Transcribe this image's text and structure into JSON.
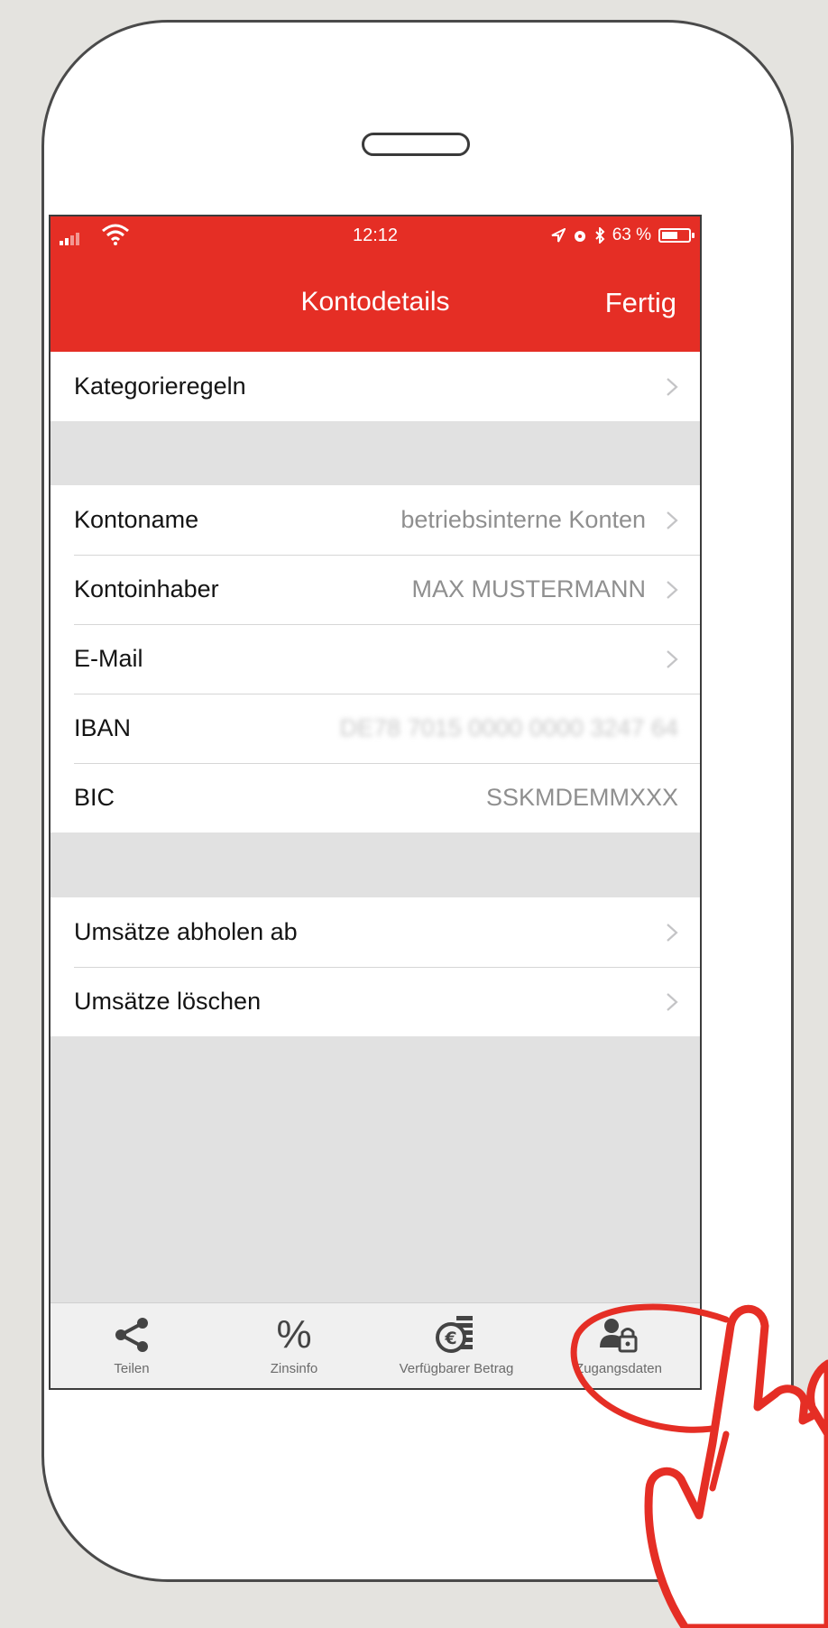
{
  "status_bar": {
    "time": "12:12",
    "battery": "63 %",
    "battery_level": 0.63
  },
  "nav": {
    "title": "Kontodetails",
    "done": "Fertig"
  },
  "sections": {
    "first": [
      {
        "label": "Kategorieregeln",
        "value": ""
      }
    ],
    "account": [
      {
        "label": "Kontoname",
        "value": "betriebsinterne Konten"
      },
      {
        "label": "Kontoinhaber",
        "value": "MAX MUSTERMANN"
      },
      {
        "label": "E-Mail",
        "value": ""
      },
      {
        "label": "IBAN",
        "value": "DE78 7015 0000 0000 3247 64"
      },
      {
        "label": "BIC",
        "value": "SSKMDEMMXXX"
      }
    ],
    "transactions": [
      {
        "label": "Umsätze abholen ab",
        "value": ""
      },
      {
        "label": "Umsätze löschen",
        "value": ""
      }
    ]
  },
  "tabbar": {
    "tabs": [
      {
        "label": "Teilen",
        "icon": "share-icon"
      },
      {
        "label": "Zinsinfo",
        "icon": "percent-icon",
        "glyph": "%"
      },
      {
        "label": "Verfügbarer Betrag",
        "icon": "coins-euro-icon"
      },
      {
        "label": "Zugangsdaten",
        "icon": "user-lock-icon"
      }
    ]
  },
  "colors": {
    "accent": "#e52e25",
    "background": "#e4e3df",
    "row_value": "#8f8f8f"
  }
}
